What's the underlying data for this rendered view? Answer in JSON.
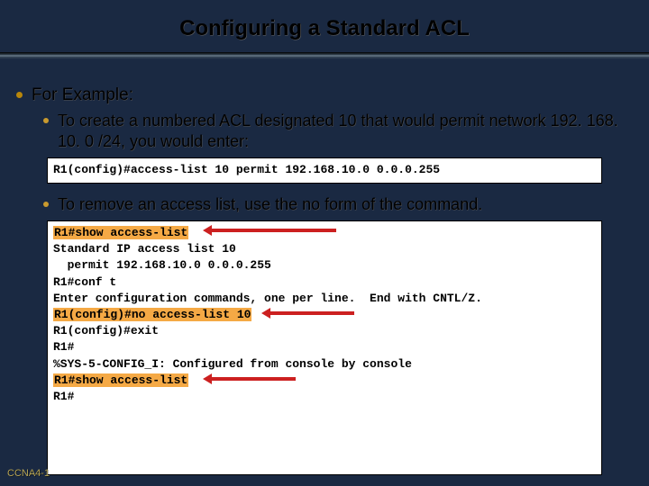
{
  "title": "Configuring a Standard ACL",
  "bullets": {
    "forExample": "For Example:",
    "create": "To create a numbered ACL designated 10 that would permit network 192. 168. 10. 0 /24, you would enter:",
    "remove": "To remove an access list, use the no form of the command."
  },
  "code1": {
    "line1": "R1(config)#access-list 10 permit 192.168.10.0 0.0.0.255"
  },
  "code2": {
    "l1": "R1#show access-list",
    "l2": "Standard IP access list 10",
    "l3": "  permit 192.168.10.0 0.0.0.255",
    "l4": "R1#conf t",
    "l5": "Enter configuration commands, one per line.  End with CNTL/Z.",
    "l6": "R1(config)#no access-list 10",
    "l7": "R1(config)#exit",
    "l8": "R1#",
    "l9": "%SYS-5-CONFIG_I: Configured from console by console",
    "l10": "R1#show access-list",
    "l11": "R1#"
  },
  "footer": {
    "left": "CCNA4-1"
  }
}
